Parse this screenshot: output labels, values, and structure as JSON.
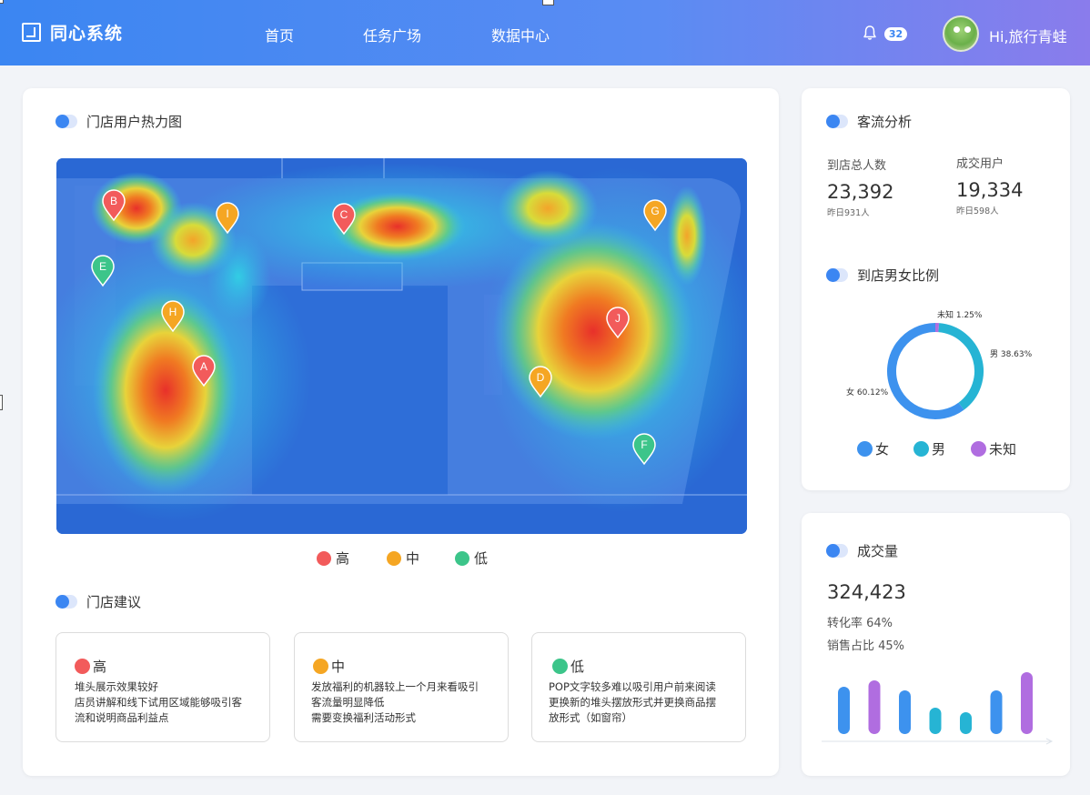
{
  "header": {
    "app_name": "同心系统",
    "nav": [
      "首页",
      "任务广场",
      "数据中心"
    ],
    "notification_count": "32",
    "greeting": "Hi,旅行青蛙"
  },
  "heatmap_card": {
    "title": "门店用户热力图",
    "markers": [
      {
        "label": "A",
        "level": "high"
      },
      {
        "label": "B",
        "level": "high"
      },
      {
        "label": "C",
        "level": "high"
      },
      {
        "label": "D",
        "level": "mid"
      },
      {
        "label": "E",
        "level": "low"
      },
      {
        "label": "F",
        "level": "low"
      },
      {
        "label": "G",
        "level": "mid"
      },
      {
        "label": "H",
        "level": "mid"
      },
      {
        "label": "I",
        "level": "mid"
      },
      {
        "label": "J",
        "level": "high"
      }
    ],
    "legend": [
      {
        "label": "高",
        "color": "#f25b5b"
      },
      {
        "label": "中",
        "color": "#f5a623"
      },
      {
        "label": "低",
        "color": "#3cc58a"
      }
    ]
  },
  "suggestions": {
    "title": "门店建议",
    "items": [
      {
        "level": "高",
        "color": "#f25b5b",
        "lines": [
          "堆头展示效果较好",
          "店员讲解和线下试用区域能够吸引客",
          "流和说明商品利益点"
        ]
      },
      {
        "level": "中",
        "color": "#f5a623",
        "lines": [
          "发放福利的机器较上一个月来看吸引",
          "客流量明显降低",
          "需要变换福利活动形式"
        ]
      },
      {
        "level": "低",
        "color": "#3cc58a",
        "lines": [
          "POP文字较多难以吸引用户前来阅读",
          "更换新的堆头摆放形式并更换商品摆",
          "放形式（如窗帘）"
        ]
      }
    ]
  },
  "traffic": {
    "title": "客流分析",
    "total_label": "到店总人数",
    "total_value": "23,392",
    "total_sub": "昨日931人",
    "deal_label": "成交用户",
    "deal_value": "19,334",
    "deal_sub": "昨日598人"
  },
  "gender": {
    "title": "到店男女比例",
    "slices": [
      {
        "name": "女",
        "percent": 60.12,
        "label": "女 60.12%",
        "color": "#3d92ee"
      },
      {
        "name": "男",
        "percent": 38.63,
        "label": "男 38.63%",
        "color": "#26b4d4"
      },
      {
        "name": "未知",
        "percent": 1.25,
        "label": "未知 1.25%",
        "color": "#b06de0"
      }
    ]
  },
  "deals": {
    "title": "成交量",
    "value": "324,423",
    "conversion": "转化率 64%",
    "sales_share": "销售占比 45%"
  },
  "chart_data": {
    "type": "bar",
    "title": "",
    "values": [
      52,
      59,
      48,
      29,
      24,
      48,
      68
    ],
    "colors": [
      "#3d92ee",
      "#b06de0",
      "#3d92ee",
      "#26b4d4",
      "#26b4d4",
      "#3d92ee",
      "#b06de0"
    ],
    "ylim": [
      0,
      70
    ],
    "grid": false
  }
}
